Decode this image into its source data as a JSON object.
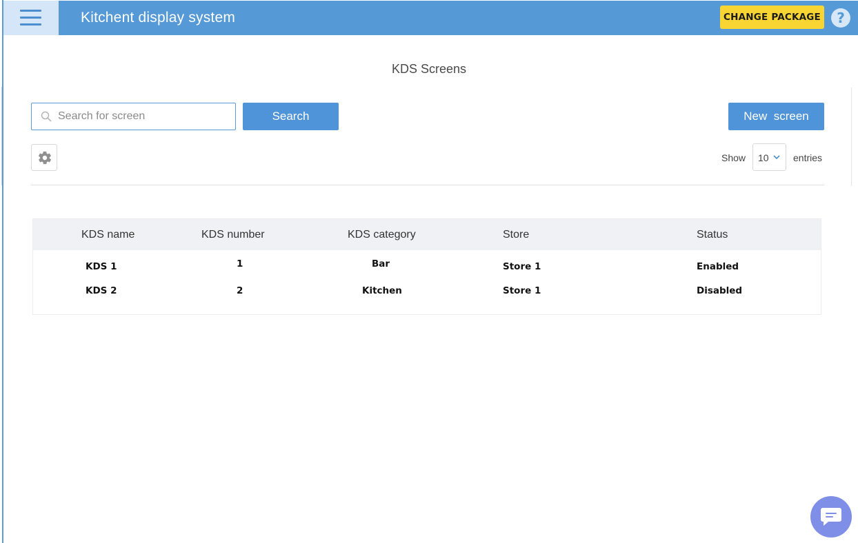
{
  "header": {
    "title": "Kitchent display system",
    "change_package_label": "CHANGE PACKAGE",
    "help_symbol": "?",
    "background_color": "#5599d6",
    "accent_color": "#f9d533"
  },
  "page": {
    "title": "KDS Screens"
  },
  "search": {
    "placeholder": "Search for screen",
    "value": "",
    "button_label": "Search"
  },
  "toolbar": {
    "new_button_label": "New  screen",
    "settings_icon": "gear-icon"
  },
  "pagination": {
    "show_label": "Show",
    "entries_value": "10",
    "entries_label": "entries"
  },
  "table": {
    "columns": [
      "KDS name",
      "KDS number",
      "KDS category",
      "Store",
      "Status"
    ],
    "rows": [
      {
        "name": "KDS 1",
        "number": "1",
        "category": "Bar",
        "store": "Store 1",
        "status": "Enabled"
      },
      {
        "name": "KDS 2",
        "number": "2",
        "category": "Kitchen",
        "store": "Store 1",
        "status": "Disabled"
      }
    ]
  },
  "chat": {
    "icon": "chat-icon",
    "color": "#7f8ee6"
  }
}
